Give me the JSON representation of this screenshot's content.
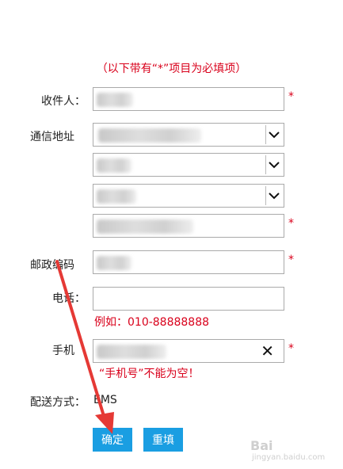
{
  "notice": "（以下带有“*”项目为必填项）",
  "required_mark": "*",
  "labels": {
    "recipient": "收件人：",
    "address": "通信地址",
    "postcode": "邮政编码",
    "phone": "电话：",
    "mobile": "手机",
    "delivery": "配送方式："
  },
  "phone_example": "例如：010-88888888",
  "mobile_error": "“手机号”不能为空！",
  "delivery_value": "EMS",
  "buttons": {
    "confirm": "确定",
    "reset": "重填"
  },
  "clear_icon": "✕",
  "watermark": {
    "brand": "Bai",
    "sub": "jingyan.baidu.com"
  },
  "colors": {
    "required": "#d9001b",
    "button": "#1a9ee2",
    "arrow": "#e53935"
  }
}
